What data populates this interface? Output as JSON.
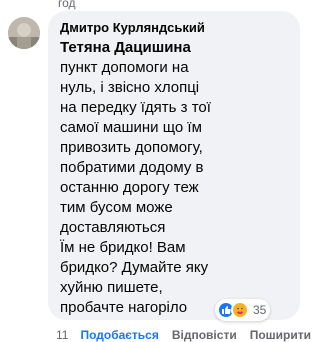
{
  "top_time": "год",
  "comment": {
    "author": "Дмитро Курляндський",
    "mention": "Тетяна Дацишина",
    "lines": [
      "пункт допомоги на",
      "нуль, і звісно хлопці",
      "на передку їдять з тої",
      "самої машини що їм",
      "привозить допомогу,",
      "побратими додому в",
      "останню дорогу теж",
      "тим бусом може",
      "доставляються",
      "Їм не бридко! Вам",
      "бридко? Думайте яку",
      "хуйню пишете,",
      "пробачте нагоріло"
    ]
  },
  "reactions": {
    "icons": [
      "like-icon",
      "care-icon"
    ],
    "count": "35",
    "colors": {
      "like": "#1877f2",
      "care": "#f7b125"
    }
  },
  "actions": {
    "time": "11",
    "like_label": "Подобається",
    "reply_label": "Відповісти",
    "share_label": "Поширити"
  },
  "colors": {
    "bubble": "#f0f2f5",
    "link": "#1877f2",
    "secondary": "#65676b"
  }
}
